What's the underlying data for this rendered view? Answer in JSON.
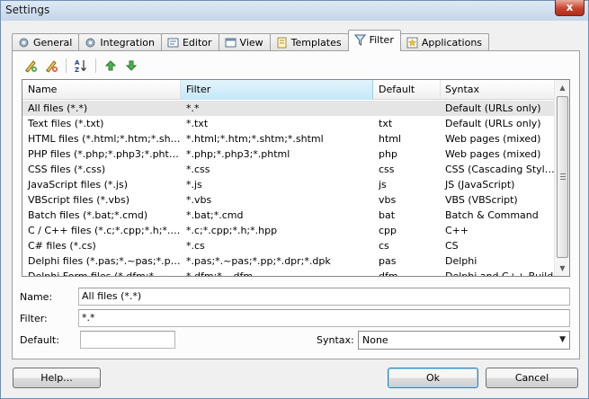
{
  "window": {
    "title": "Settings",
    "close_glyph": "x"
  },
  "tabs": [
    {
      "label": "General",
      "icon": "gear-icon"
    },
    {
      "label": "Integration",
      "icon": "gear-icon"
    },
    {
      "label": "Editor",
      "icon": "editor-icon"
    },
    {
      "label": "View",
      "icon": "window-icon"
    },
    {
      "label": "Templates",
      "icon": "template-icon"
    },
    {
      "label": "Filter",
      "icon": "funnel-icon"
    },
    {
      "label": "Applications",
      "icon": "star-icon"
    }
  ],
  "active_tab": "Filter",
  "toolbar": {
    "buttons": [
      "add-filter-icon",
      "edit-filter-icon",
      "sort-az-icon",
      "move-up-icon",
      "move-down-icon"
    ],
    "sort_top": "A",
    "sort_bottom": "Z"
  },
  "list": {
    "columns": [
      "Name",
      "Filter",
      "Default",
      "Syntax"
    ],
    "sorted_column": "Filter",
    "rows": [
      [
        "All files (*.*)",
        "*.*",
        "",
        "Default (URLs only)"
      ],
      [
        "Text files (*.txt)",
        "*.txt",
        "txt",
        "Default (URLs only)"
      ],
      [
        "HTML files (*.html;*.htm;*.shtml)",
        "*.html;*.htm;*.shtm;*.shtml",
        "html",
        "Web pages (mixed)"
      ],
      [
        "PHP files (*.php;*.php3;*.phtml)",
        "*.php;*.php3;*.phtml",
        "php",
        "Web pages (mixed)"
      ],
      [
        "CSS files (*.css)",
        "*.css",
        "css",
        "CSS (Cascading Style Sheets)"
      ],
      [
        "JavaScript files (*.js)",
        "*.js",
        "js",
        "JS (JavaScript)"
      ],
      [
        "VBScript files (*.vbs)",
        "*.vbs",
        "vbs",
        "VBS (VBScript)"
      ],
      [
        "Batch files (*.bat;*.cmd)",
        "*.bat;*.cmd",
        "bat",
        "Batch & Command"
      ],
      [
        "C / C++ files (*.c;*.cpp;*.h;*.hpp)",
        "*.c;*.cpp;*.h;*.hpp",
        "cpp",
        "C++"
      ],
      [
        "C# files (*.cs)",
        "*.cs",
        "cs",
        "CS"
      ],
      [
        "Delphi files (*.pas;*.~pas;*.pp;*.dpr;*.dpk)",
        "*.pas;*.~pas;*.pp;*.dpr;*.dpk",
        "pas",
        "Delphi"
      ],
      [
        "Delphi Form files (*.dfm;*.~dfm)",
        "*.dfm;*.~dfm",
        "dfm",
        "Delphi and C++ Build"
      ]
    ],
    "selected_index": 0
  },
  "form": {
    "name_label": "Name:",
    "name_value": "All files (*.*)",
    "filter_label": "Filter:",
    "filter_value": "*.*",
    "default_label": "Default:",
    "default_value": "",
    "syntax_label": "Syntax:",
    "syntax_value": "None"
  },
  "buttons": {
    "help": "Help...",
    "ok": "Ok",
    "cancel": "Cancel"
  },
  "colors": {
    "selected_row": "#e5e5e5",
    "sorted_header": "#c4e8f8",
    "add_green": "#3aa53a"
  }
}
